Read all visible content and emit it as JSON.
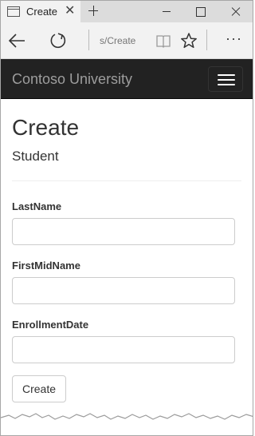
{
  "browser": {
    "tab_title": "Create",
    "tab_close_glyph": "✕",
    "url": "s/Create",
    "more_glyph": "···"
  },
  "site": {
    "brand": "Contoso University"
  },
  "page": {
    "title": "Create",
    "subtitle": "Student"
  },
  "form": {
    "fields": [
      {
        "label": "LastName",
        "value": ""
      },
      {
        "label": "FirstMidName",
        "value": ""
      },
      {
        "label": "EnrollmentDate",
        "value": ""
      }
    ],
    "submit_label": "Create"
  },
  "colors": {
    "navbar_bg": "#222222",
    "brand_text": "#9d9d9d",
    "tab_strip_bg": "#dcdcdc",
    "address_bar_bg": "#f2f2f2"
  },
  "icons": [
    "browser-tab-icon",
    "close-icon",
    "plus-icon",
    "minimize-icon",
    "maximize-icon",
    "window-close-icon",
    "back-arrow-icon",
    "refresh-icon",
    "reading-view-icon",
    "star-icon",
    "more-icon",
    "hamburger-icon"
  ]
}
